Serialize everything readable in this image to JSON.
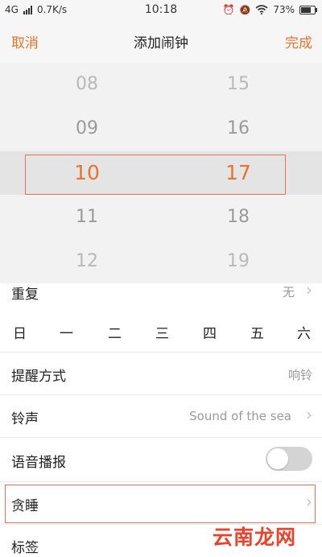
{
  "status_bar": {
    "network": "4G",
    "speed": "0.7K/s",
    "time": "10:18",
    "battery": "73%"
  },
  "header": {
    "cancel": "取消",
    "title": "添加闹钟",
    "done": "完成"
  },
  "time_picker": {
    "hours": [
      "08",
      "09",
      "10",
      "11",
      "12"
    ],
    "minutes": [
      "15",
      "16",
      "17",
      "18",
      "19"
    ],
    "selected_hour": "10",
    "selected_minute": "17"
  },
  "settings": {
    "repeat": {
      "label": "重复",
      "value": "无"
    },
    "weekdays": [
      "日",
      "一",
      "二",
      "三",
      "四",
      "五",
      "六"
    ],
    "reminder": {
      "label": "提醒方式",
      "value": "响铃"
    },
    "ringtone": {
      "label": "铃声",
      "value": "Sound of the sea"
    },
    "voice": {
      "label": "语音播报",
      "enabled": false
    },
    "snooze": {
      "label": "贪睡"
    },
    "tag": {
      "label": "标签"
    }
  },
  "watermark": "云南龙网",
  "colors": {
    "accent": "#e8732c",
    "highlight_border": "#e87060",
    "watermark": "#e8432c"
  }
}
